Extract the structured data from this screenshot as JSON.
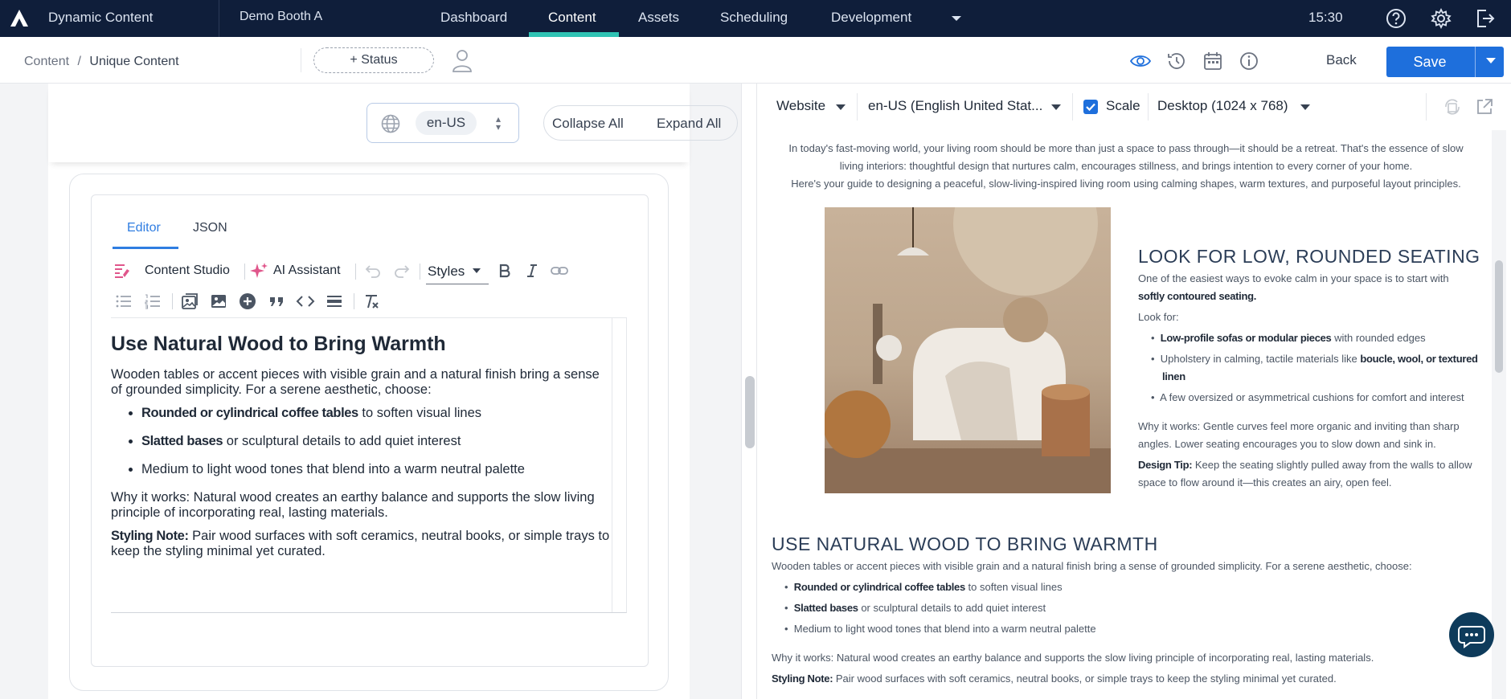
{
  "nav": {
    "app_name": "Dynamic Content",
    "site": "Demo Booth A",
    "tabs": [
      "Dashboard",
      "Content",
      "Assets",
      "Scheduling",
      "Development"
    ],
    "active_tab": "Content",
    "time": "15:30"
  },
  "subbar": {
    "breadcrumb_root": "Content",
    "breadcrumb_sep": "/",
    "breadcrumb_current": "Unique Content",
    "status_button": "+ Status",
    "back": "Back",
    "save": "Save"
  },
  "editor_toolbar": {
    "locale": "en-US",
    "collapse_all": "Collapse All",
    "expand_all": "Expand All",
    "tab_editor": "Editor",
    "tab_json": "JSON",
    "content_studio": "Content Studio",
    "ai_assistant": "AI Assistant",
    "styles": "Styles"
  },
  "editor_content": {
    "heading": "Use Natural Wood to Bring Warmth",
    "intro": "Wooden tables or accent pieces with visible grain and a natural finish bring a sense of grounded simplicity. For a serene aesthetic, choose:",
    "items": [
      {
        "bold": "Rounded or cylindrical coffee tables",
        "rest": " to soften visual lines"
      },
      {
        "bold": "Slatted bases",
        "rest": " or sculptural details to add quiet interest"
      },
      {
        "bold": "",
        "rest": "Medium to light wood tones that blend into a warm neutral palette"
      }
    ],
    "why": "Why it works: Natural wood creates an earthy balance and supports the slow living principle of incorporating real, lasting materials.",
    "note_label": "Styling Note:",
    "note_text": " Pair wood surfaces with soft ceramics, neutral books, or simple trays to keep the styling minimal yet curated."
  },
  "preview_bar": {
    "channel": "Website",
    "locale": "en-US (English United Stat...",
    "scale_label": "Scale",
    "scale_checked": true,
    "device": "Desktop (1024 x 768)"
  },
  "preview": {
    "intro_line1": "In today's fast-moving world, your living room should be more than just a space to pass through—it should be a retreat. That's the essence of slow",
    "intro_line2": "living interiors: thoughtful design that nurtures calm, encourages stillness, and brings intention to every corner of your home.",
    "intro_line3": "Here's your guide to designing a peaceful, slow-living-inspired living room using calming shapes, warm textures, and purposeful layout principles.",
    "seating_heading": "LOOK FOR LOW, ROUNDED SEATING",
    "seating_p1": "One of the easiest ways to evoke calm in your space is to start with",
    "seating_p1b": "softly contoured seating.",
    "look_for": "Look for:",
    "seating_items": [
      {
        "bold": "Low-profile sofas or modular pieces",
        "rest": " with rounded edges"
      },
      {
        "bold": "",
        "rest": "Upholstery in calming, tactile materials like ",
        "bold2": "boucle, wool, or textured"
      },
      {
        "bold": "linen",
        "rest": ""
      },
      {
        "bold": "",
        "rest": "A few oversized or asymmetrical cushions for comfort and interest"
      }
    ],
    "seating_why1": "Why it works: Gentle curves feel more organic and inviting than sharp",
    "seating_why2": "angles. Lower seating encourages you to slow down and sink in.",
    "design_tip_label": "Design Tip:",
    "design_tip1": " Keep the seating slightly pulled away from the walls to allow",
    "design_tip2": "space to flow around it—this creates an airy, open feel.",
    "wood_heading": "USE NATURAL WOOD TO BRING WARMTH",
    "wood_intro": "Wooden tables or accent pieces with visible grain and a natural finish bring a sense of grounded simplicity. For a serene aesthetic, choose:",
    "wood_items": [
      {
        "bold": "Rounded or cylindrical coffee tables",
        "rest": " to soften visual lines"
      },
      {
        "bold": "Slatted bases",
        "rest": " or sculptural details to add quiet interest"
      },
      {
        "bold": "",
        "rest": "Medium to light wood tones that blend into a warm neutral palette"
      }
    ],
    "wood_why": "Why it works: Natural wood creates an earthy balance and supports the slow living principle of incorporating real, lasting materials.",
    "wood_note_label": "Styling Note:",
    "wood_note": " Pair wood surfaces with soft ceramics, neutral books, or simple trays to keep the styling minimal yet curated."
  },
  "colors": {
    "nav_bg": "#0f1e3a",
    "accent": "#2fc3b4",
    "primary": "#1e6fdc",
    "heading_blue": "#2b3d57"
  }
}
